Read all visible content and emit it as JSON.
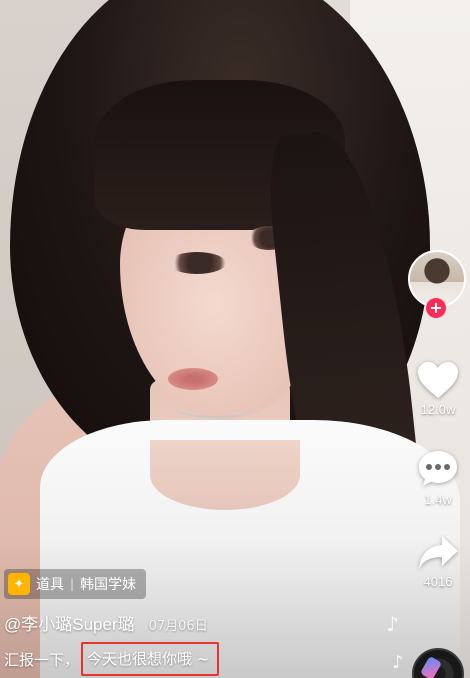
{
  "colors": {
    "accent": "#fe2c55",
    "highlight_border": "#e8322c",
    "effect_badge": "#ffb400"
  },
  "video": {
    "description_icon": "video-frame"
  },
  "actions": {
    "follow_symbol": "+",
    "like_count": "12.0w",
    "comment_count": "1.4w",
    "share_count": "4016"
  },
  "effect": {
    "label": "道具",
    "divider": "|",
    "name": "韩国学妹"
  },
  "author": {
    "handle": "@李小璐Super璐",
    "date": "07月06日"
  },
  "caption": {
    "prefix": "汇报一下，",
    "highlighted": "今天也很想你哦 ~"
  }
}
